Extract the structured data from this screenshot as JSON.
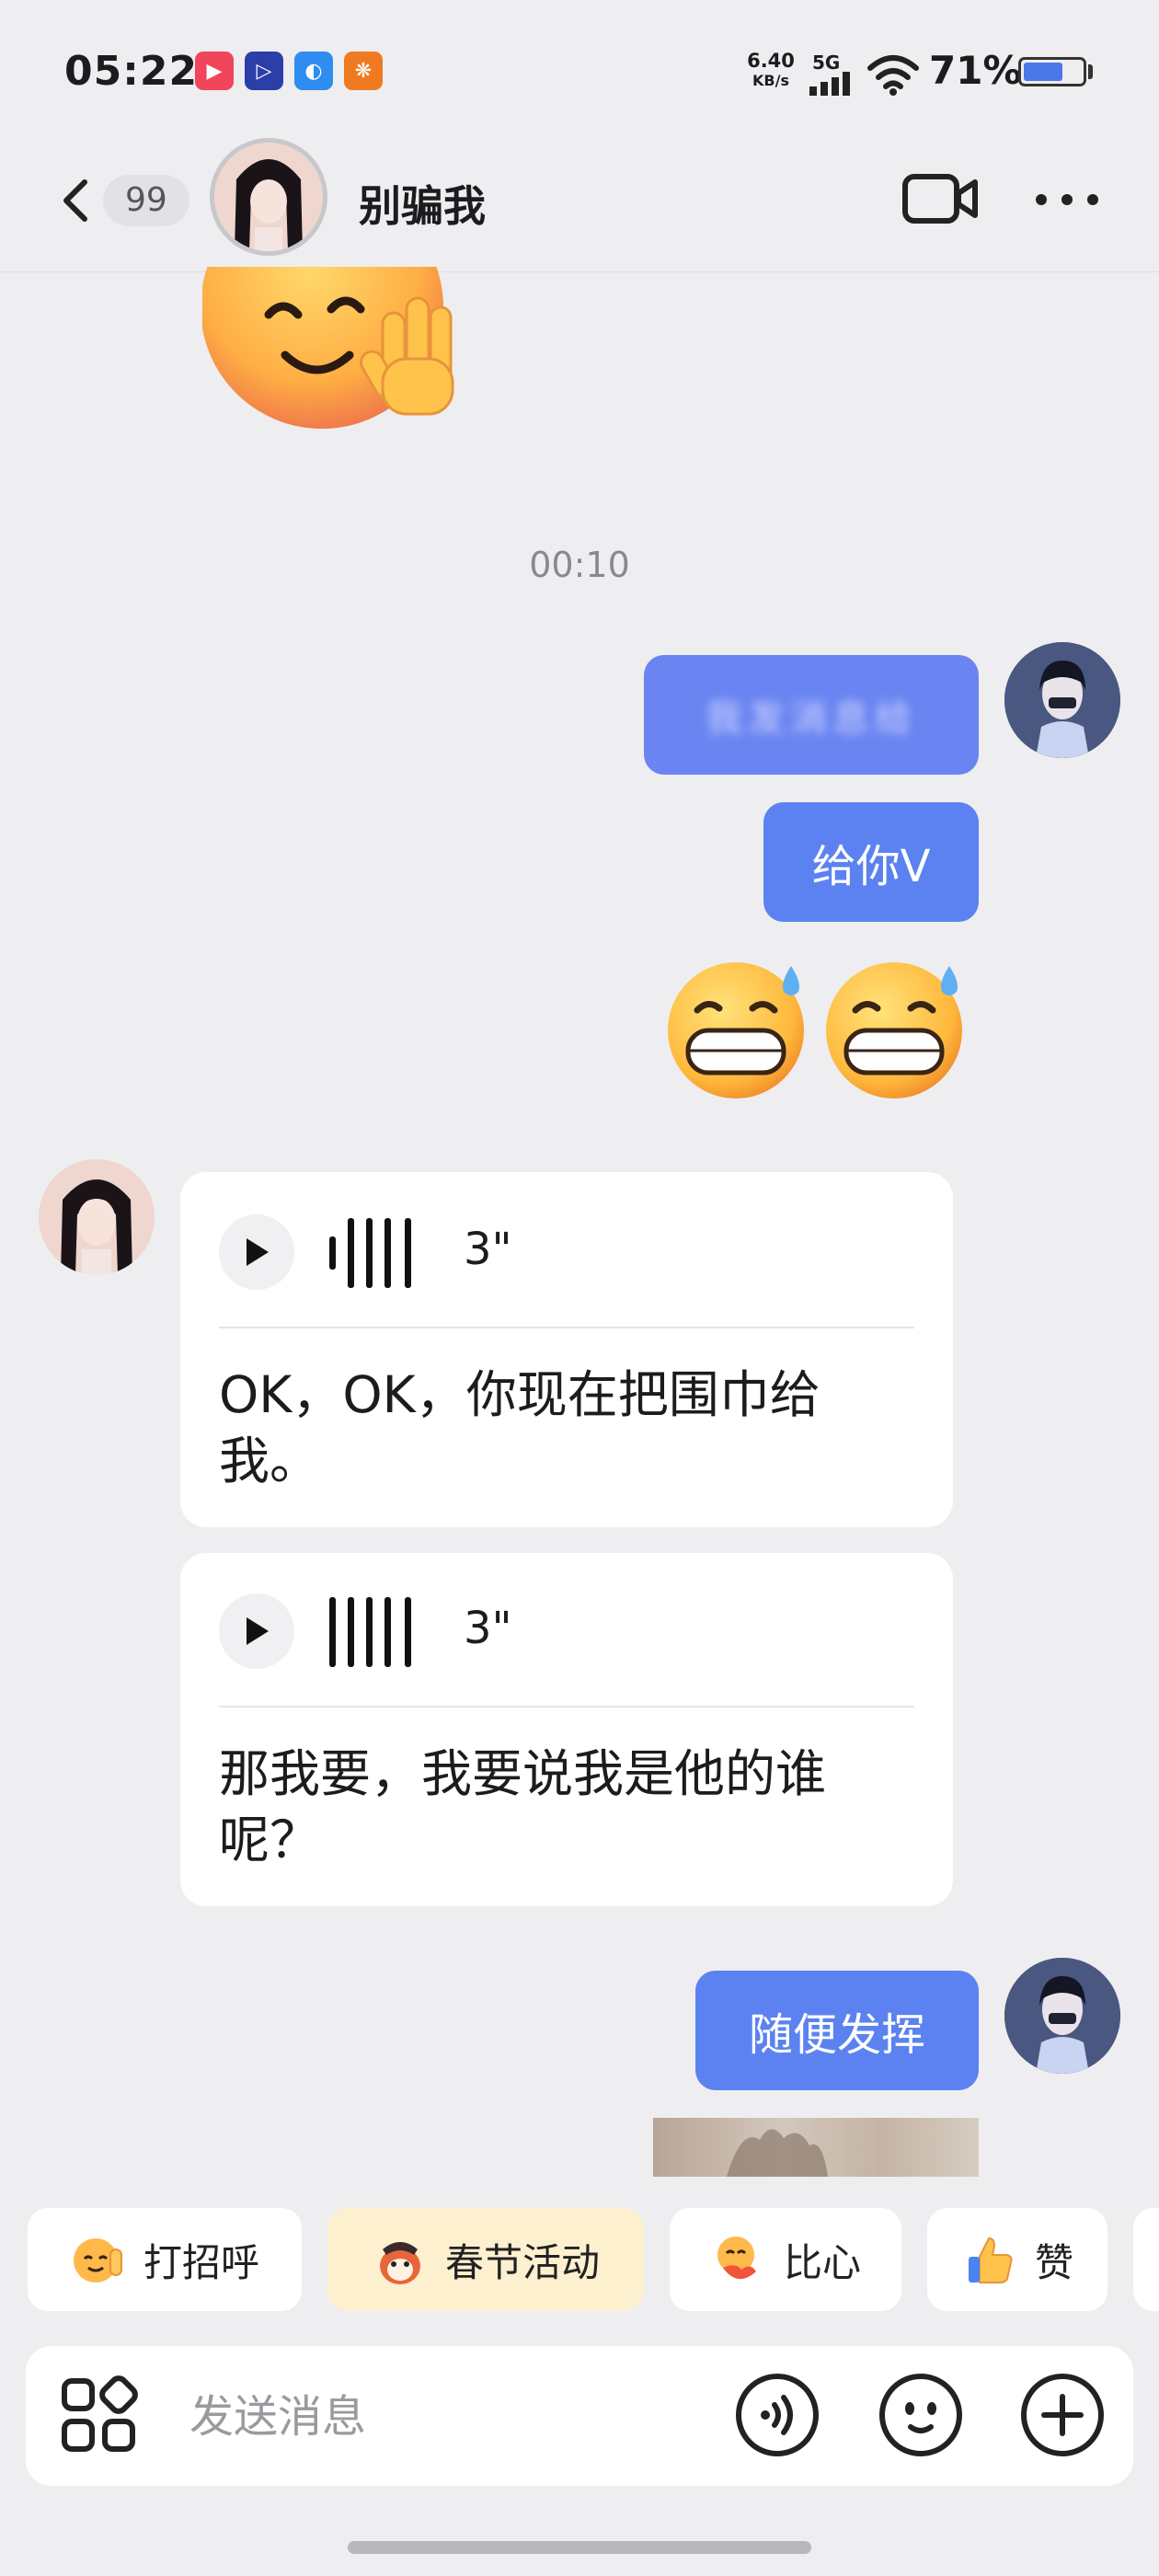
{
  "status_bar": {
    "time": "05:22",
    "net_speed_value": "6.40",
    "net_speed_unit": "KB/s",
    "net_type": "5G",
    "battery": "71%",
    "battery_level": 0.71
  },
  "header": {
    "unread_count": "99",
    "contact_name": "别骗我"
  },
  "chat": {
    "timestamp": "00:10",
    "messages": {
      "me_blurred": "我发消息给",
      "me_v": "给你V",
      "voice_1": {
        "duration": "3\"",
        "transcript": "OK，OK，你现在把围巾给我。"
      },
      "voice_2": {
        "duration": "3\"",
        "transcript": "那我要，我要说我是他的谁呢？"
      },
      "me_free": "随便发挥"
    }
  },
  "quick_replies": [
    {
      "label": "打招呼",
      "icon": "wave-hand-emoji"
    },
    {
      "label": "春节活动",
      "icon": "spring-festival-mascot"
    },
    {
      "label": "比心",
      "icon": "heart-hands-emoji"
    },
    {
      "label": "赞",
      "icon": "thumbs-up-emoji"
    }
  ],
  "input": {
    "placeholder": "发送消息"
  },
  "colors": {
    "accent": "#5b82f0",
    "background": "#eeeef0",
    "festival_chip": "#fdf0cf"
  }
}
